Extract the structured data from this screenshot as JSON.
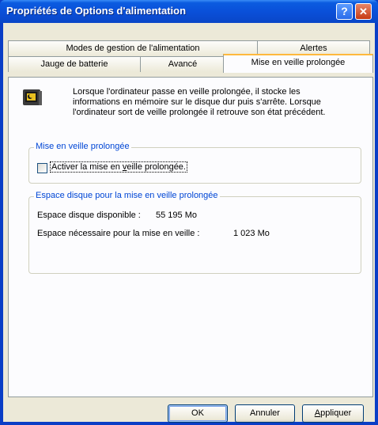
{
  "window": {
    "title": "Propriétés de Options d'alimentation",
    "help_glyph": "?",
    "close_glyph": "✕"
  },
  "tabs_back": [
    {
      "label": "Modes de gestion de l'alimentation"
    },
    {
      "label": "Alertes"
    }
  ],
  "tabs_front": [
    {
      "label": "Jauge de batterie"
    },
    {
      "label": "Avancé"
    },
    {
      "label": "Mise en veille prolongée",
      "active": true
    }
  ],
  "panel": {
    "icon": "hibernate-computer-icon",
    "info_lines": [
      "Lorsque l'ordinateur passe en veille prolongée, il stocke les",
      "informations en mémoire sur le disque dur puis s'arrête. Lorsque",
      "l'ordinateur sort de veille prolongée il retrouve son état précédent."
    ],
    "hibernate_group": {
      "title": "Mise en veille prolongée",
      "checkbox_label_parts": [
        "Activer la mise en ",
        "v",
        "eille prolongée."
      ],
      "checked": false
    },
    "disk_group": {
      "title": "Espace disque pour la mise en veille prolongée",
      "free_label": "Espace disque disponible :",
      "free_value": "55 195 Mo",
      "needed_label": "Espace nécessaire pour la mise en veille :",
      "needed_value": "1 023 Mo"
    }
  },
  "buttons": {
    "ok": "OK",
    "cancel": "Annuler",
    "apply_first": "A",
    "apply_rest": "ppliquer"
  },
  "colors": {
    "title_bar": "#0a4fd8",
    "dialog_bg": "#ece9d8",
    "active_tab_highlight": "#ffb93c",
    "group_title": "#0046d5"
  }
}
